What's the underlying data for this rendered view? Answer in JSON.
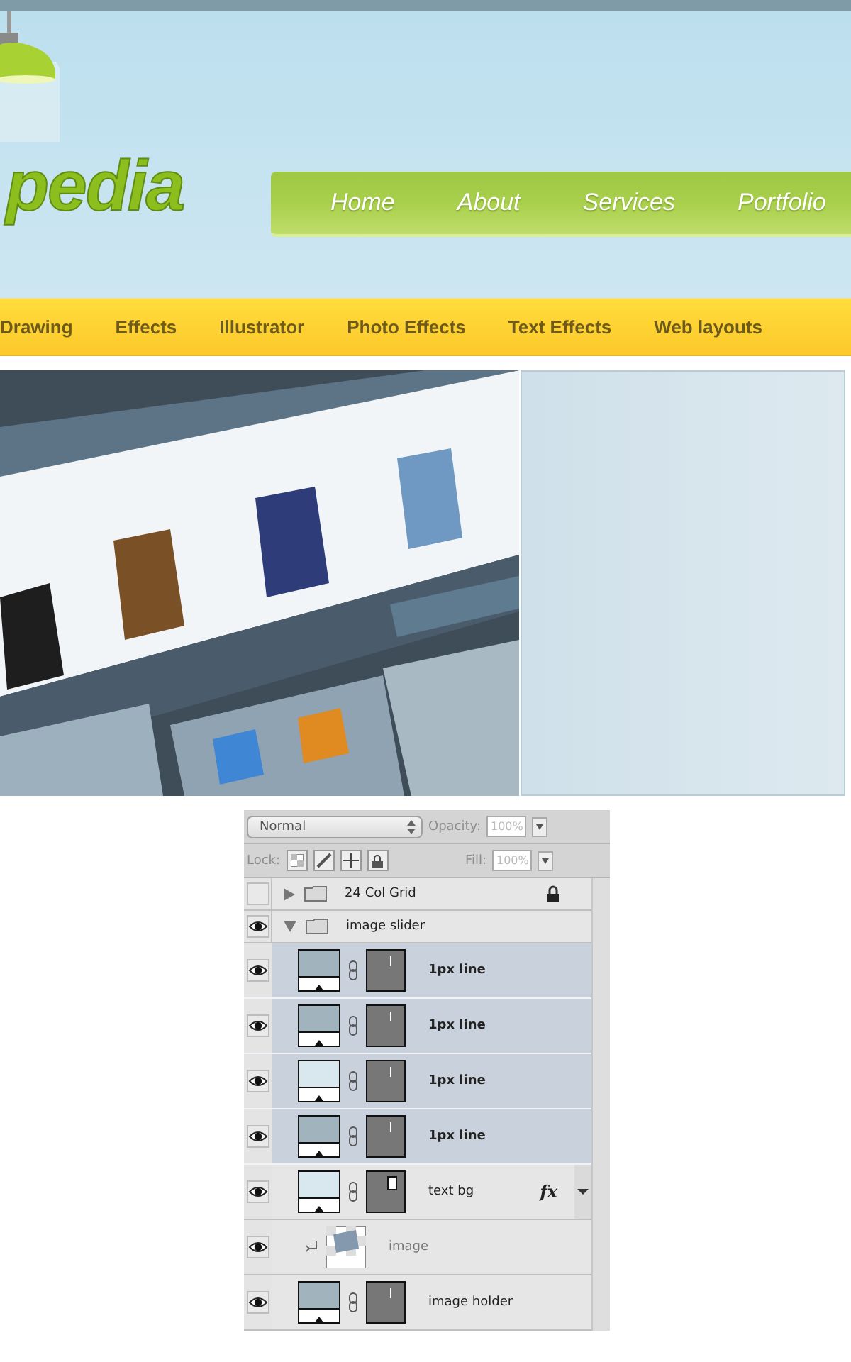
{
  "site": {
    "logo": "pedia",
    "nav": [
      {
        "label": "Home"
      },
      {
        "label": "About"
      },
      {
        "label": "Services"
      },
      {
        "label": "Portfolio"
      }
    ],
    "categories": [
      {
        "label": "Drawing"
      },
      {
        "label": "Effects"
      },
      {
        "label": "Illustrator"
      },
      {
        "label": "Photo Effects"
      },
      {
        "label": "Text Effects"
      },
      {
        "label": "Web layouts"
      }
    ]
  },
  "layers_panel": {
    "blend_mode": {
      "value": "Normal"
    },
    "opacity": {
      "label": "Opacity:",
      "value": "100%",
      "disabled": true
    },
    "lock": {
      "label": "Lock:"
    },
    "fill": {
      "label": "Fill:",
      "value": "100%",
      "disabled": true
    },
    "layers": [
      {
        "kind": "group",
        "name": "24 Col Grid",
        "visible": false,
        "expanded": false,
        "locked": true
      },
      {
        "kind": "group",
        "name": "image slider",
        "visible": true,
        "expanded": true,
        "locked": false,
        "children": [
          {
            "kind": "shape",
            "name": "1px line",
            "visible": true,
            "selected": true,
            "color": "#a1b4bd"
          },
          {
            "kind": "shape",
            "name": "1px line",
            "visible": true,
            "selected": true,
            "color": "#a1b4bd"
          },
          {
            "kind": "shape",
            "name": "1px line",
            "visible": true,
            "selected": true,
            "color": "#d9e8ef"
          },
          {
            "kind": "shape",
            "name": "1px line",
            "visible": true,
            "selected": true,
            "color": "#a1b4bd"
          },
          {
            "kind": "shape",
            "name": "text bg",
            "visible": true,
            "selected": false,
            "color": "#d9e8ef",
            "effects": "fx"
          },
          {
            "name": "image",
            "visible": true,
            "selected": false,
            "clipped": true
          },
          {
            "kind": "shape",
            "name": "image holder",
            "visible": true,
            "selected": false,
            "color": "#a1b4bd"
          }
        ]
      }
    ]
  }
}
